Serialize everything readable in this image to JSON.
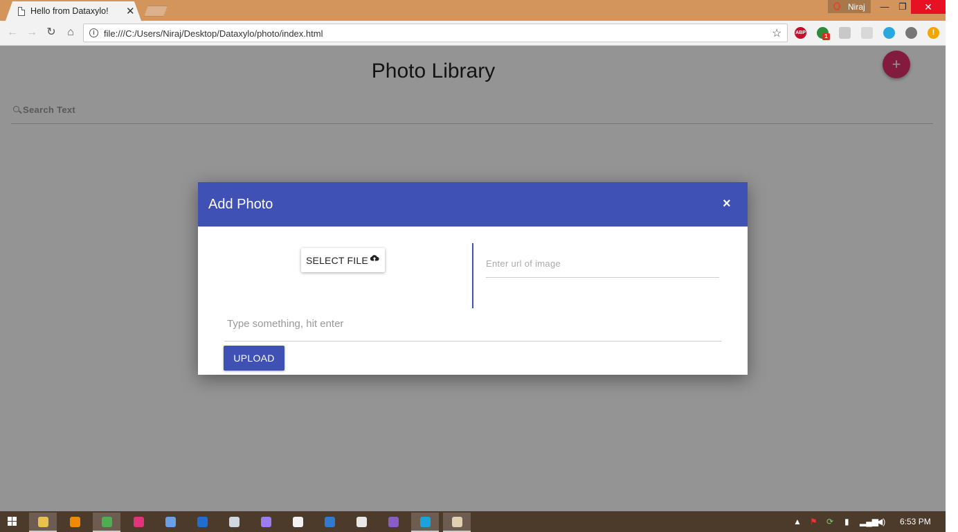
{
  "browser": {
    "tab_title": "Hello from Dataxylo!",
    "tab_close": "✕",
    "profile_name": "Niraj",
    "url": "file:///C:/Users/Niraj/Desktop/Dataxylo/photo/index.html",
    "window_controls": {
      "minimize": "—",
      "restore": "❐",
      "close": "✕"
    },
    "nav_icons": {
      "back": "←",
      "forward": "→",
      "reload": "↻",
      "home": "⌂"
    },
    "star": "☆",
    "info": "i",
    "extensions": [
      {
        "name": "abp-icon",
        "label": "ABP",
        "color": "#c70d2c"
      },
      {
        "name": "extension-green-icon",
        "label": "",
        "badge": "1",
        "color": "#2e8b3a"
      },
      {
        "name": "extension-image-icon",
        "label": "",
        "color": "#c8c8c8"
      },
      {
        "name": "extension-gray-icon",
        "label": "",
        "color": "#d8d8d8"
      },
      {
        "name": "extension-blue-icon",
        "label": "",
        "color": "#29a8e0"
      },
      {
        "name": "extension-gear-icon",
        "label": "",
        "color": "#777777"
      },
      {
        "name": "extension-warning-icon",
        "label": "!",
        "color": "#f2a600"
      }
    ]
  },
  "page": {
    "title": "Photo Library",
    "fab_label": "+",
    "search_placeholder": "Search Text",
    "accent_color": "#3f51b5",
    "fab_color": "#e2306c"
  },
  "modal": {
    "title": "Add Photo",
    "close_label": "×",
    "select_file_label": "SELECT FILE",
    "url_placeholder": "Enter url of image",
    "tags_placeholder": "Type something, hit enter",
    "upload_label": "UPLOAD"
  },
  "taskbar": {
    "time": "6:53 PM",
    "apps": [
      {
        "name": "file-explorer-icon",
        "color": "#e8c14a",
        "active": true
      },
      {
        "name": "vlc-icon",
        "color": "#f08a00",
        "active": false
      },
      {
        "name": "chrome-icon",
        "color": "#4caf50",
        "active": true
      },
      {
        "name": "app-pink-icon",
        "color": "#e0357c",
        "active": false
      },
      {
        "name": "app-box-icon",
        "color": "#6aa0e8",
        "active": false
      },
      {
        "name": "firefox-icon",
        "color": "#1f6fd1",
        "active": false
      },
      {
        "name": "app-circle-icon",
        "color": "#cfd8e0",
        "active": false
      },
      {
        "name": "app-purple-icon",
        "color": "#9b7cf2",
        "active": false
      },
      {
        "name": "calculator-icon",
        "color": "#f2f2f2",
        "active": false
      },
      {
        "name": "app-chart-icon",
        "color": "#2e7bd1",
        "active": false
      },
      {
        "name": "app-window-icon",
        "color": "#e8e8e8",
        "active": false
      },
      {
        "name": "visual-studio-icon",
        "color": "#8a5cc7",
        "active": false
      },
      {
        "name": "skype-icon",
        "color": "#1da2e0",
        "active": true
      },
      {
        "name": "paint-icon",
        "color": "#e0d2b0",
        "active": true
      }
    ]
  }
}
